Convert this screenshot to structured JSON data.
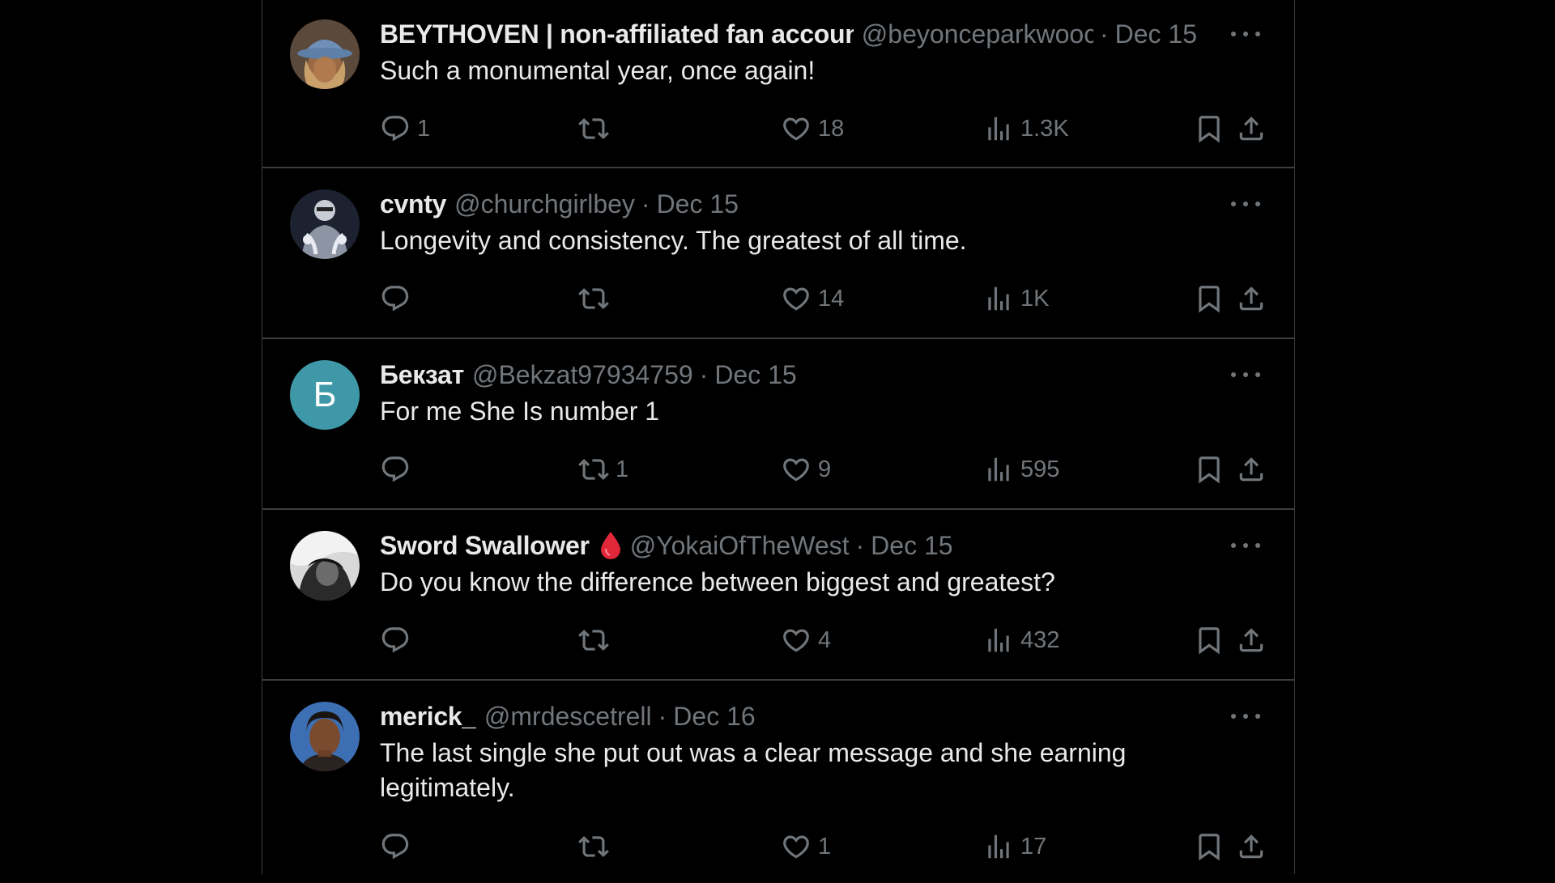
{
  "tweets": [
    {
      "name": "BEYTHOVEN | non-affiliated fan accoun",
      "handle": "@beyonceparkwooc",
      "separator": "·",
      "date": "Dec 15",
      "text": "Such a monumental year, once again!",
      "replies": "1",
      "retweets": "",
      "likes": "18",
      "views": "1.3K",
      "avatar_icon": "cowboy-hat-portrait"
    },
    {
      "name": "cvnty",
      "handle": "@churchgirlbey",
      "separator": "·",
      "date": "Dec 15",
      "text": "Longevity and consistency. The greatest of all time.",
      "replies": "",
      "retweets": "",
      "likes": "14",
      "views": "1K",
      "avatar_icon": "chrome-figure-portrait"
    },
    {
      "name": "Бекзат",
      "handle": "@Bekzat97934759",
      "separator": "·",
      "date": "Dec 15",
      "text": "For me She Is number 1",
      "replies": "",
      "retweets": "1",
      "likes": "9",
      "views": "595",
      "avatar_letter": "Б"
    },
    {
      "name": "Sword Swallower",
      "handle": "@YokaiOfTheWest",
      "separator": "·",
      "date": "Dec 15",
      "text": "Do you know the difference between biggest and greatest?",
      "replies": "",
      "retweets": "",
      "likes": "4",
      "views": "432",
      "name_emoji": "drop-of-blood-icon",
      "avatar_icon": "monochrome-portrait"
    },
    {
      "name": "merick_",
      "handle": "@mrdescetrell",
      "separator": "·",
      "date": "Dec 16",
      "text": "The last single she put out was a clear message and she earning legitimately.",
      "replies": "",
      "retweets": "",
      "likes": "1",
      "views": "17",
      "avatar_icon": "sky-portrait"
    }
  ],
  "colors": {
    "background": "#000000",
    "text_primary": "#e7e9ea",
    "text_secondary": "#71767b",
    "divider": "#3a3d41",
    "letter_avatar": "#3f98a8",
    "drop_emoji": "#e0283a"
  }
}
